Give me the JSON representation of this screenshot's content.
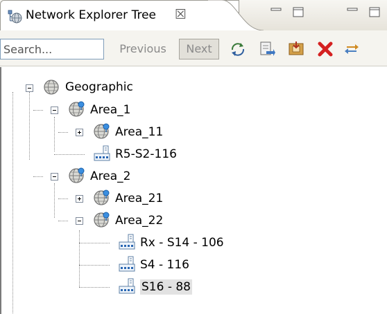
{
  "tab": {
    "title": "Network Explorer Tree",
    "close_symbol": "☒",
    "icon": "network-tree-icon"
  },
  "toolbar": {
    "search_placeholder": "Search...",
    "previous_label": "Previous",
    "next_label": "Next",
    "icons": [
      "refresh-icon",
      "export-icon",
      "import-icon",
      "delete-icon",
      "sync-icon"
    ]
  },
  "tree": {
    "root": {
      "label": "Geographic",
      "expanded": true,
      "children": [
        {
          "label": "Area_1",
          "expanded": true,
          "children": [
            {
              "label": "Area_11",
              "expanded": false,
              "type": "area"
            },
            {
              "label": "R5-S2-116",
              "type": "site"
            }
          ]
        },
        {
          "label": "Area_2",
          "expanded": true,
          "children": [
            {
              "label": "Area_21",
              "expanded": false,
              "type": "area"
            },
            {
              "label": "Area_22",
              "expanded": true,
              "type": "area",
              "children": [
                {
                  "label": "Rx - S14 - 106",
                  "type": "site"
                },
                {
                  "label": "S4 - 116",
                  "type": "site"
                },
                {
                  "label": "S16 - 88",
                  "type": "site",
                  "selected": true
                }
              ]
            }
          ]
        }
      ]
    }
  }
}
